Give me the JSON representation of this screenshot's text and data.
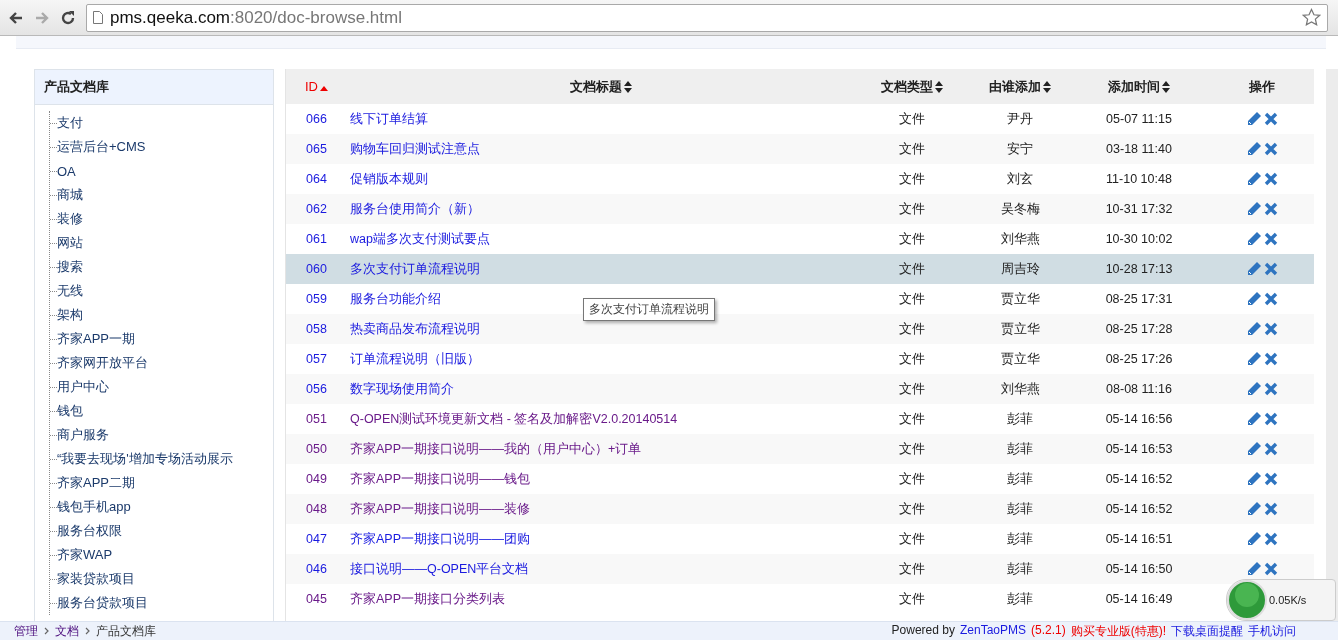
{
  "browser": {
    "url_host": "pms.qeeka.com",
    "url_path": ":8020/doc-browse.html"
  },
  "sidebar": {
    "title": "产品文档库",
    "items": [
      "支付",
      "运营后台+CMS",
      "OA",
      "商城",
      "装修",
      "网站",
      "搜索",
      "无线",
      "架构",
      "齐家APP一期",
      "齐家网开放平台",
      "用户中心",
      "钱包",
      "商户服务",
      "“我要去现场'增加专场活动展示",
      "齐家APP二期",
      "钱包手机app",
      "服务台权限",
      "齐家WAP",
      "家装贷款项目",
      "服务台贷款项目"
    ]
  },
  "table": {
    "columns": [
      {
        "label": "ID",
        "sortable": true,
        "sorted": true
      },
      {
        "label": "文档标题",
        "sortable": true,
        "sorted": false
      },
      {
        "label": "文档类型",
        "sortable": true,
        "sorted": false
      },
      {
        "label": "由谁添加",
        "sortable": true,
        "sorted": false
      },
      {
        "label": "添加时间",
        "sortable": true,
        "sorted": false
      },
      {
        "label": "操作",
        "sortable": false,
        "sorted": false
      }
    ],
    "rows": [
      {
        "id": "066",
        "title": "线下订单结算",
        "type": "文件",
        "by": "尹丹",
        "time": "05-07 11:15",
        "visited": false,
        "selected": false
      },
      {
        "id": "065",
        "title": "购物车回归测试注意点",
        "type": "文件",
        "by": "安宁",
        "time": "03-18 11:40",
        "visited": false,
        "selected": false
      },
      {
        "id": "064",
        "title": "促销版本规则",
        "type": "文件",
        "by": "刘玄",
        "time": "11-10 10:48",
        "visited": false,
        "selected": false
      },
      {
        "id": "062",
        "title": "服务台使用简介（新）",
        "type": "文件",
        "by": "吴冬梅",
        "time": "10-31 17:32",
        "visited": false,
        "selected": false
      },
      {
        "id": "061",
        "title": "wap端多次支付测试要点",
        "type": "文件",
        "by": "刘华燕",
        "time": "10-30 10:02",
        "visited": false,
        "selected": false
      },
      {
        "id": "060",
        "title": "多次支付订单流程说明",
        "type": "文件",
        "by": "周吉玲",
        "time": "10-28 17:13",
        "visited": false,
        "selected": true
      },
      {
        "id": "059",
        "title": "服务台功能介绍",
        "type": "文件",
        "by": "贾立华",
        "time": "08-25 17:31",
        "visited": false,
        "selected": false
      },
      {
        "id": "058",
        "title": "热卖商品发布流程说明",
        "type": "文件",
        "by": "贾立华",
        "time": "08-25 17:28",
        "visited": false,
        "selected": false
      },
      {
        "id": "057",
        "title": "订单流程说明（旧版）",
        "type": "文件",
        "by": "贾立华",
        "time": "08-25 17:26",
        "visited": false,
        "selected": false
      },
      {
        "id": "056",
        "title": "数字现场使用简介",
        "type": "文件",
        "by": "刘华燕",
        "time": "08-08 11:16",
        "visited": false,
        "selected": false
      },
      {
        "id": "051",
        "title": "Q-OPEN测试环境更新文档 - 签名及加解密V2.0.20140514",
        "type": "文件",
        "by": "彭菲",
        "time": "05-14 16:56",
        "visited": true,
        "selected": false
      },
      {
        "id": "050",
        "title": "齐家APP一期接口说明——我的（用户中心）+订单",
        "type": "文件",
        "by": "彭菲",
        "time": "05-14 16:53",
        "visited": true,
        "selected": false
      },
      {
        "id": "049",
        "title": "齐家APP一期接口说明——钱包",
        "type": "文件",
        "by": "彭菲",
        "time": "05-14 16:52",
        "visited": true,
        "selected": false
      },
      {
        "id": "048",
        "title": "齐家APP一期接口说明——装修",
        "type": "文件",
        "by": "彭菲",
        "time": "05-14 16:52",
        "visited": true,
        "selected": false
      },
      {
        "id": "047",
        "title": "齐家APP一期接口说明——团购",
        "type": "文件",
        "by": "彭菲",
        "time": "05-14 16:51",
        "visited": false,
        "selected": false
      },
      {
        "id": "046",
        "title": "接口说明——Q-OPEN平台文档",
        "type": "文件",
        "by": "彭菲",
        "time": "05-14 16:50",
        "visited": false,
        "selected": false
      },
      {
        "id": "045",
        "title": "齐家APP一期接口分类列表",
        "type": "文件",
        "by": "彭菲",
        "time": "05-14 16:49",
        "visited": true,
        "selected": false
      }
    ]
  },
  "tooltip": "多次支付订单流程说明",
  "speed_widget": {
    "rate": "0.05K/s"
  },
  "footer": {
    "breadcrumb": [
      "管理",
      "文档",
      "产品文档库"
    ],
    "powered": "Powered by",
    "product": "ZenTaoPMS",
    "version": "(5.2.1)",
    "buy": "购买专业版(特惠)!",
    "download": "下载桌面提醒",
    "mobile": "手机访问"
  }
}
